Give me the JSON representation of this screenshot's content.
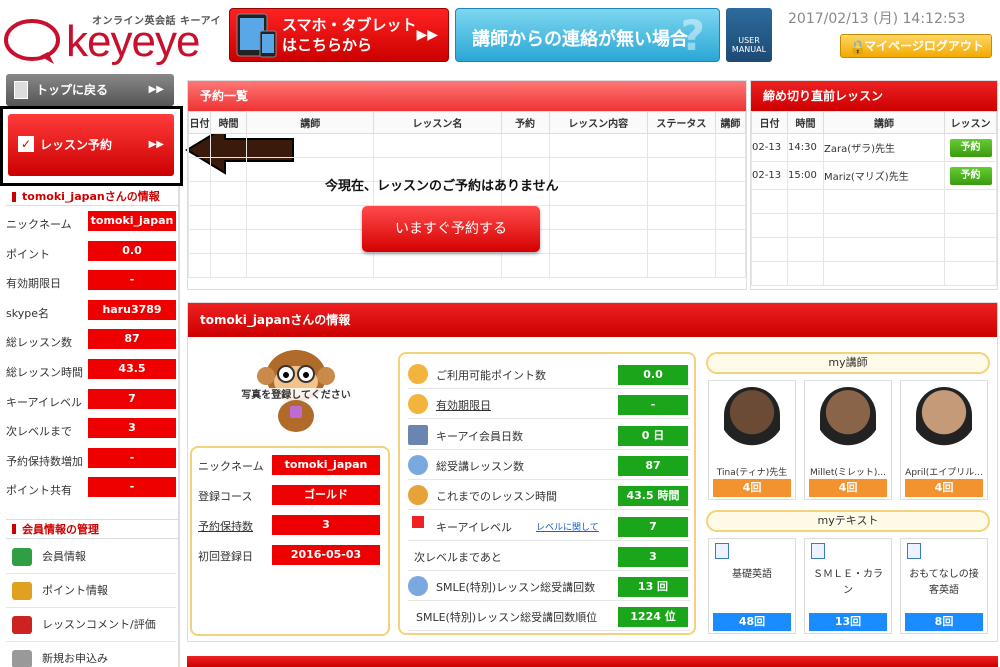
{
  "header": {
    "logo_sub": "オンライン英会話 キーアイ",
    "logo_text": "keyeye",
    "banner_mobile": "スマホ・タブレットはこちらから",
    "banner_contact": "講師からの連絡が無い場合",
    "banner_manual": "USER MANUAL",
    "datetime": "2017/02/13 (月) 14:12:53",
    "logout": "マイページログアウト",
    "accent_color": "#e60012"
  },
  "sidebar": {
    "top_label": "トップに戻る",
    "book_label": "レッスン予約",
    "user_info_title": "tomoki_japanさんの情報",
    "info_rows": [
      {
        "label": "ニックネーム",
        "value": "tomoki_japan"
      },
      {
        "label": "ポイント",
        "value": "0.0"
      },
      {
        "label": "有効期限日",
        "value": "-"
      },
      {
        "label": "skype名",
        "value": "haru3789"
      },
      {
        "label": "総レッスン数",
        "value": "87"
      },
      {
        "label": "総レッスン時間",
        "value": "43.5"
      },
      {
        "label": "キーアイレベル",
        "value": "7"
      },
      {
        "label": "次レベルまで",
        "value": "3"
      },
      {
        "label": "予約保持数増加",
        "value": "-"
      },
      {
        "label": "ポイント共有",
        "value": "-"
      }
    ],
    "member_title": "会員情報の管理",
    "menu": [
      "会員情報",
      "ポイント情報",
      "レッスンコメント/評価",
      "新規お申込み"
    ]
  },
  "reservations": {
    "title": "予約一覧",
    "columns": [
      "日付",
      "時間",
      "講師",
      "レッスン名",
      "予約",
      "レッスン内容",
      "ステータス",
      "講師"
    ],
    "empty_message": "今現在、レッスンのご予約はありません",
    "book_now": "いますぐ予約する"
  },
  "deadline": {
    "title": "締め切り直前レッスン",
    "columns": [
      "日付",
      "時間",
      "講師",
      "レッスン"
    ],
    "rows": [
      {
        "date": "02-13",
        "time": "14:30",
        "teacher": "Zara(ザラ)先生",
        "action": "予約"
      },
      {
        "date": "02-13",
        "time": "15:00",
        "teacher": "Mariz(マリズ)先生",
        "action": "予約"
      }
    ]
  },
  "user_info": {
    "title": "tomoki_japanさんの情報",
    "photo_caption": "写真を登録してください",
    "fields": [
      {
        "label": "ニックネーム",
        "value": "tomoki_japan"
      },
      {
        "label": "登録コース",
        "value": "ゴールド"
      },
      {
        "label": "予約保持数",
        "value": "3"
      },
      {
        "label": "初回登録日",
        "value": "2016-05-03"
      }
    ],
    "stats": [
      {
        "label": "ご利用可能ポイント数",
        "value": "0.0",
        "icon": "coin-icon"
      },
      {
        "label": "有効期限日",
        "value": "-",
        "icon": "coin-icon"
      },
      {
        "label": "キーアイ会員日数",
        "value": "0 日",
        "icon": "calendar-icon"
      },
      {
        "label": "総受講レッスン数",
        "value": "87",
        "icon": "chat-icon"
      },
      {
        "label": "これまでのレッスン時間",
        "value": "43.5 時間",
        "icon": "clock-icon"
      },
      {
        "label": "キーアイレベル",
        "value": "7",
        "icon": "flag-icon",
        "link": "レベルに関して"
      },
      {
        "label": "次レベルまであと",
        "value": "3",
        "icon": ""
      },
      {
        "label": "SMLE(特別)レッスン総受講回数",
        "value": "13 回",
        "icon": "chat-icon"
      },
      {
        "label": "SMLE(特別)レッスン総受講回数順位",
        "value": "1224 位",
        "icon": ""
      }
    ],
    "my_teachers_title": "my講師",
    "teachers": [
      {
        "name": "Tina(ティナ)先生",
        "count": "4回"
      },
      {
        "name": "Millet(ミレット)...",
        "count": "4回"
      },
      {
        "name": "April(エイプリル...",
        "count": "4回"
      }
    ],
    "my_texts_title": "myテキスト",
    "texts": [
      {
        "name": "基礎英語",
        "count": "48回"
      },
      {
        "name": "ＳＭＬＥ・カラン",
        "count": "13回"
      },
      {
        "name": "おもてなしの接客英語",
        "count": "8回"
      }
    ]
  }
}
